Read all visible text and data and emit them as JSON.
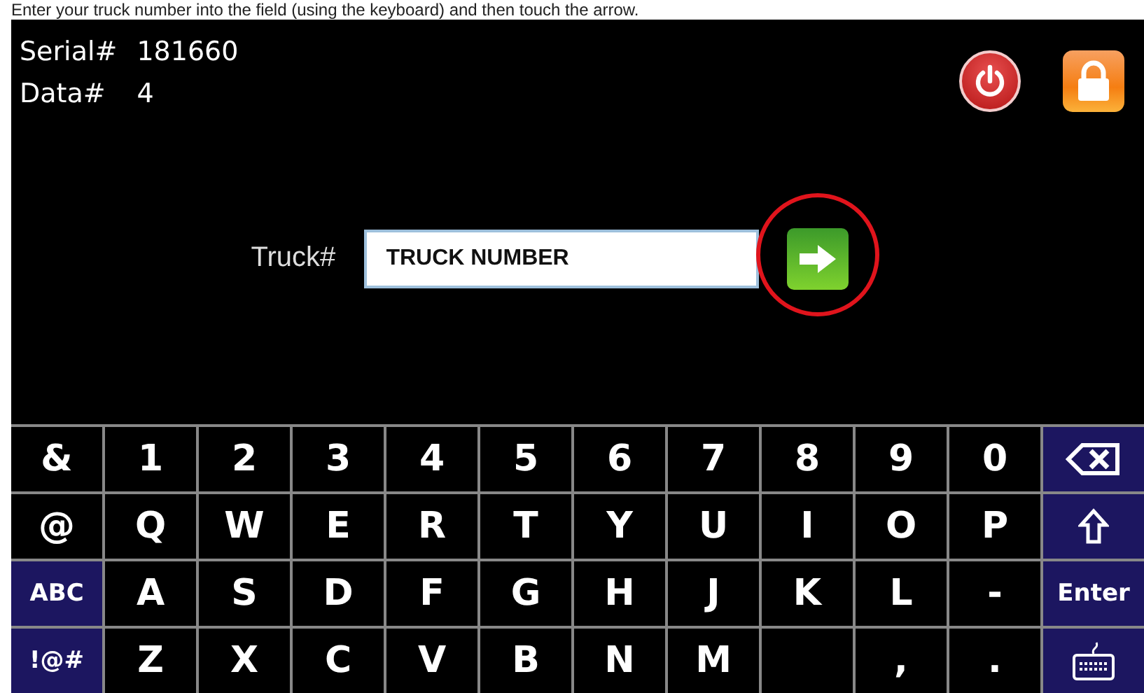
{
  "instruction": "Enter your truck number into the field (using the keyboard) and then touch the arrow.",
  "info": [
    {
      "label": "Serial#",
      "value": "181660"
    },
    {
      "label": "Data#",
      "value": "4"
    }
  ],
  "truck_field": {
    "label": "Truck#",
    "value": "TRUCK NUMBER",
    "highlighted": true
  },
  "keyboard": [
    [
      {
        "kind": "char",
        "label": "&"
      },
      {
        "kind": "char",
        "label": "1"
      },
      {
        "kind": "char",
        "label": "2"
      },
      {
        "kind": "char",
        "label": "3"
      },
      {
        "kind": "char",
        "label": "4"
      },
      {
        "kind": "char",
        "label": "5"
      },
      {
        "kind": "char",
        "label": "6"
      },
      {
        "kind": "char",
        "label": "7"
      },
      {
        "kind": "char",
        "label": "8"
      },
      {
        "kind": "char",
        "label": "9"
      },
      {
        "kind": "char",
        "label": "0"
      },
      {
        "kind": "backspace"
      }
    ],
    [
      {
        "kind": "char",
        "label": "@"
      },
      {
        "kind": "char",
        "label": "Q"
      },
      {
        "kind": "char",
        "label": "W"
      },
      {
        "kind": "char",
        "label": "E"
      },
      {
        "kind": "char",
        "label": "R"
      },
      {
        "kind": "char",
        "label": "T"
      },
      {
        "kind": "char",
        "label": "Y"
      },
      {
        "kind": "char",
        "label": "U"
      },
      {
        "kind": "char",
        "label": "I"
      },
      {
        "kind": "char",
        "label": "O"
      },
      {
        "kind": "char",
        "label": "P"
      },
      {
        "kind": "shift"
      }
    ],
    [
      {
        "kind": "function",
        "label": "ABC"
      },
      {
        "kind": "char",
        "label": "A"
      },
      {
        "kind": "char",
        "label": "S"
      },
      {
        "kind": "char",
        "label": "D"
      },
      {
        "kind": "char",
        "label": "F"
      },
      {
        "kind": "char",
        "label": "G"
      },
      {
        "kind": "char",
        "label": "H"
      },
      {
        "kind": "char",
        "label": "J"
      },
      {
        "kind": "char",
        "label": "K"
      },
      {
        "kind": "char",
        "label": "L"
      },
      {
        "kind": "char",
        "label": "-"
      },
      {
        "kind": "function",
        "label": "Enter"
      }
    ],
    [
      {
        "kind": "function",
        "label": "!@#"
      },
      {
        "kind": "char",
        "label": "Z"
      },
      {
        "kind": "char",
        "label": "X"
      },
      {
        "kind": "char",
        "label": "C"
      },
      {
        "kind": "char",
        "label": "V"
      },
      {
        "kind": "char",
        "label": "B"
      },
      {
        "kind": "char",
        "label": "N"
      },
      {
        "kind": "char",
        "label": "M"
      },
      {
        "kind": "blank"
      },
      {
        "kind": "char",
        "label": ","
      },
      {
        "kind": "char",
        "label": "."
      },
      {
        "kind": "hide"
      }
    ]
  ]
}
